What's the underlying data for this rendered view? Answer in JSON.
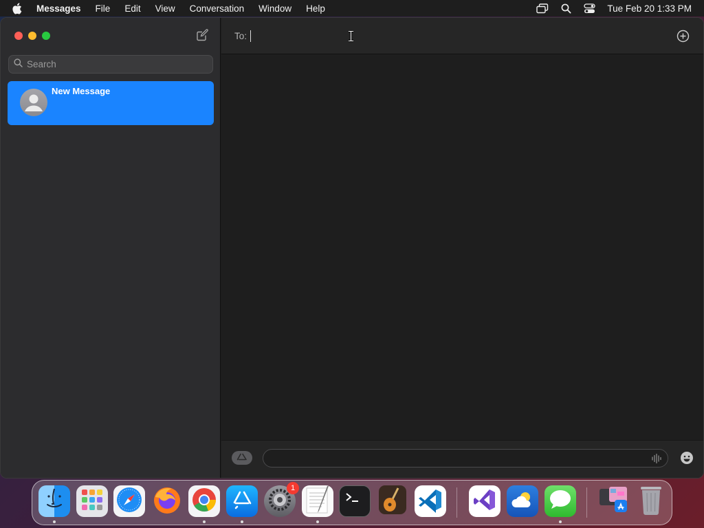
{
  "menubar": {
    "app_name": "Messages",
    "items": [
      "File",
      "Edit",
      "View",
      "Conversation",
      "Window",
      "Help"
    ],
    "clock": "Tue Feb 20  1:33 PM",
    "icons": [
      "apple-logo-icon",
      "screen-mirroring-icon",
      "spotlight-search-icon",
      "control-center-icon"
    ]
  },
  "sidebar": {
    "search_placeholder": "Search",
    "conversations": [
      {
        "name": "New Message",
        "selected": true
      }
    ]
  },
  "main": {
    "to_label": "To:",
    "to_value": "",
    "message_value": ""
  },
  "dock": {
    "apps": [
      {
        "name": "Finder",
        "icon": "finder-icon",
        "running": true
      },
      {
        "name": "Launchpad",
        "icon": "launchpad-icon",
        "running": false
      },
      {
        "name": "Safari",
        "icon": "safari-icon",
        "running": false
      },
      {
        "name": "Firefox",
        "icon": "firefox-icon",
        "running": false
      },
      {
        "name": "Google Chrome",
        "icon": "chrome-icon",
        "running": true
      },
      {
        "name": "App Store",
        "icon": "app-store-icon",
        "running": true
      },
      {
        "name": "System Settings",
        "icon": "system-settings-icon",
        "running": false,
        "badge": "1"
      },
      {
        "name": "TextEdit",
        "icon": "textedit-icon",
        "running": true
      },
      {
        "name": "Terminal",
        "icon": "terminal-icon",
        "running": false
      },
      {
        "name": "GarageBand",
        "icon": "garageband-icon",
        "running": false
      },
      {
        "name": "Visual Studio Code",
        "icon": "vscode-icon",
        "running": false
      },
      {
        "name": "Visual Studio",
        "icon": "visual-studio-icon",
        "running": false
      },
      {
        "name": "Weather",
        "icon": "weather-icon",
        "running": false
      },
      {
        "name": "Messages",
        "icon": "messages-icon",
        "running": true
      },
      {
        "name": "Downloads Stack",
        "icon": "downloads-stack-icon",
        "running": false
      },
      {
        "name": "Trash",
        "icon": "trash-icon",
        "running": false
      }
    ]
  },
  "colors": {
    "accent": "#1a84ff",
    "window_bg": "#1e1e1e",
    "sidebar_bg": "#2c2c2e",
    "badge": "#f53a30"
  }
}
